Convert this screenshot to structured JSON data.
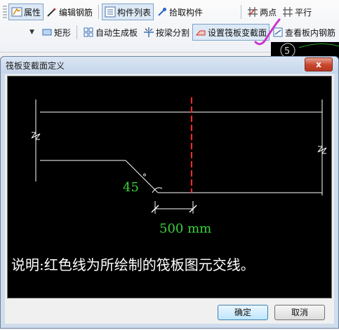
{
  "toolbar": {
    "row1": {
      "properties": "属性",
      "edit_rebar": "编辑钢筋",
      "component_list": "构件列表",
      "pick_component": "拾取构件",
      "two_points": "两点",
      "parallel": "平行"
    },
    "row2": {
      "rectangle": "矩形",
      "auto_generate": "自动生成板",
      "split_by_beam": "按梁分割",
      "set_raft_section": "设置筏板变截面",
      "view_slab_rebar": "查看板内钢筋"
    }
  },
  "canvas_marker": "5",
  "dialog": {
    "title": "筏板变截面定义",
    "close": "x",
    "ok": "确定",
    "cancel": "取消"
  },
  "diagram": {
    "angle_label": "45",
    "degree": "°",
    "dim_label": "500 mm",
    "note": "说明:红色线为所绘制的筏板图元交线。"
  },
  "colors": {
    "red_line": "#ff2a2a",
    "dim_green": "#3ad13a",
    "white": "#ffffff",
    "annotation": "#cc33cc"
  }
}
